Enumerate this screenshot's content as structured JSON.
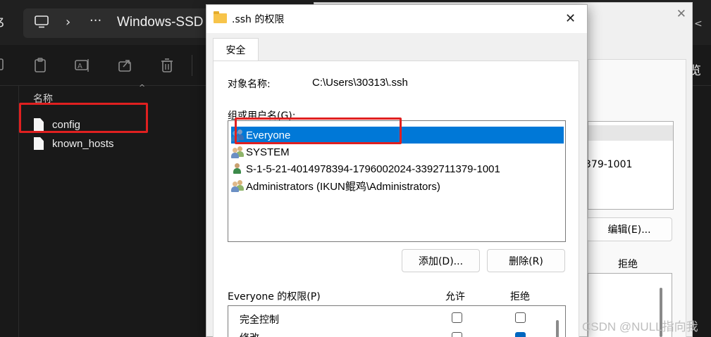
{
  "explorer": {
    "address_text": "Windows-SSD",
    "column_header_name": "名称",
    "files": [
      {
        "name": "config"
      },
      {
        "name": "known_hosts"
      }
    ],
    "right_edge_text": "览",
    "toolbar_icons": [
      "copy-icon",
      "paste-icon",
      "rename-icon",
      "share-icon",
      "delete-icon"
    ]
  },
  "bg_dialog": {
    "sid_fragment": "379-1001",
    "edit_button": "编辑(E)...",
    "deny_header": "拒绝"
  },
  "dialog": {
    "title": ".ssh 的权限",
    "tab_security": "安全",
    "object_label": "对象名称:",
    "object_path": "C:\\Users\\30313\\.ssh",
    "group_label": "组或用户名(G):",
    "principals": [
      {
        "name": "Everyone",
        "selected": true,
        "icon": "group-user-icon"
      },
      {
        "name": "SYSTEM",
        "selected": false,
        "icon": "group-user-icon"
      },
      {
        "name": "S-1-5-21-4014978394-1796002024-3392711379-1001",
        "selected": false,
        "icon": "single-user-icon"
      },
      {
        "name": "Administrators (IKUN鲲鸡\\Administrators)",
        "selected": false,
        "icon": "group-user-icon"
      }
    ],
    "add_button": "添加(D)...",
    "remove_button": "删除(R)",
    "perm_label": "Everyone 的权限(P)",
    "allow_header": "允许",
    "deny_header": "拒绝",
    "permissions": [
      {
        "name": "完全控制",
        "allow": false,
        "deny": false
      },
      {
        "name": "修改",
        "allow": false,
        "deny": true
      }
    ]
  },
  "watermark": "CSDN @NULL指向我",
  "colors": {
    "selection": "#0078d7",
    "highlight_box": "#e02020",
    "explorer_bg": "#191919"
  }
}
